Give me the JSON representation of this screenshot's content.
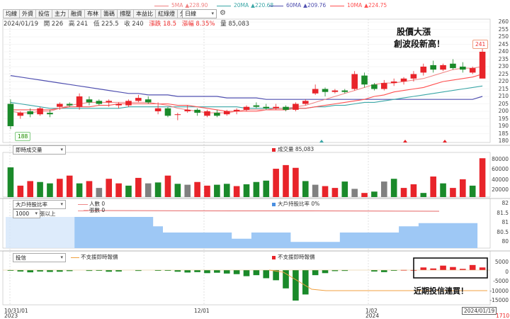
{
  "toolbar": {
    "tabs": [
      "均線",
      "外資",
      "投信",
      "主力",
      "融資",
      "布林",
      "籌碼",
      "撐壓",
      "本益比",
      "紅綠燈",
      "分價量"
    ],
    "period": "日線"
  },
  "ma_legend": [
    {
      "label": "5MA",
      "arrow": "▲",
      "value": "228.90",
      "color": "#f08080"
    },
    {
      "label": "20MA",
      "arrow": "▲",
      "value": "220.68",
      "color": "#3aa6a6"
    },
    {
      "label": "60MA",
      "arrow": "▲",
      "value": "209.76",
      "color": "#5050b0"
    },
    {
      "label": "10MA",
      "arrow": "▲",
      "value": "224.75",
      "color": "#ff5050"
    }
  ],
  "info": {
    "date": "2024/01/19",
    "open": "開 226",
    "high": "高 241",
    "low": "低 225.5",
    "close": "收 240",
    "change": "漲跌 18.5",
    "pct": "漲幅 8.35%",
    "volume": "量 85,083"
  },
  "annotations": {
    "line1": "股價大漲",
    "line2": "創波段新高！",
    "bottom": "近期投信連買！"
  },
  "price_axis": [
    "260",
    "255",
    "250",
    "245",
    "240",
    "235",
    "230",
    "225",
    "220",
    "215",
    "210",
    "205",
    "200",
    "195",
    "190",
    "185",
    "180"
  ],
  "price_high_chip": "241",
  "price_low_chip": "188",
  "volume_panel": {
    "selector": "即時成交量",
    "legend": "成交量 85,083",
    "axis": [
      "80000",
      "60000",
      "40000",
      "20000"
    ]
  },
  "big_panel": {
    "selector": "大戶持股比率",
    "count_selector": "1000",
    "count_suffix": "張以上",
    "legend_people": "人數 0",
    "legend_shares": "張數 0",
    "legend_ratio": "大戶持股比率 0%",
    "axis": [
      "82",
      "81.5",
      "81",
      "80.5",
      "80"
    ]
  },
  "inst_panel": {
    "selector": "投信",
    "legend_line": "不支援即時報價",
    "legend_bar": "不支援即時報價",
    "axis": [
      "5000",
      "0",
      "-5000",
      "-10000",
      "-15000"
    ]
  },
  "x_axis": {
    "labels": [
      "10/31/01",
      "12/01",
      "1/02"
    ],
    "years": [
      "2023",
      "2024"
    ],
    "current_date": "2024/01/19",
    "right_edge": "1710"
  },
  "colors": {
    "up": "#e8242a",
    "down": "#1a8a2a",
    "neutral": "#808080"
  },
  "chart_data": {
    "type": "candlestick",
    "ylim": [
      180,
      262
    ],
    "ohlc": [
      [
        205,
        208,
        188,
        190
      ],
      [
        197,
        200,
        195,
        199
      ],
      [
        200,
        202,
        196,
        198
      ],
      [
        198,
        203,
        197,
        202
      ],
      [
        199,
        201,
        196,
        198
      ],
      [
        203,
        206,
        201,
        205
      ],
      [
        205,
        206,
        203,
        204
      ],
      [
        203,
        212,
        201,
        210
      ],
      [
        208,
        210,
        204,
        206
      ],
      [
        207,
        208,
        204,
        205
      ],
      [
        206,
        208,
        203,
        207
      ],
      [
        204,
        206,
        202,
        205
      ],
      [
        204,
        208,
        203,
        207
      ],
      [
        207,
        211,
        206,
        209
      ],
      [
        208,
        210,
        205,
        206
      ],
      [
        200,
        206,
        198,
        202
      ],
      [
        202,
        203,
        196,
        197
      ],
      [
        198,
        199,
        194,
        198
      ],
      [
        200,
        204,
        199,
        201
      ],
      [
        201,
        202,
        197,
        199
      ],
      [
        197,
        201,
        196,
        200
      ],
      [
        199,
        201,
        196,
        197
      ],
      [
        198,
        201,
        197,
        200
      ],
      [
        200,
        202,
        198,
        201
      ],
      [
        201,
        204,
        200,
        203
      ],
      [
        204,
        206,
        202,
        203
      ],
      [
        203,
        205,
        201,
        202
      ],
      [
        202,
        205,
        201,
        203
      ],
      [
        203,
        204,
        200,
        201
      ],
      [
        201,
        206,
        200,
        205
      ],
      [
        205,
        208,
        204,
        207
      ],
      [
        212,
        218,
        211,
        215
      ],
      [
        215,
        216,
        210,
        213
      ],
      [
        213,
        215,
        212,
        214
      ],
      [
        214,
        215,
        212,
        213
      ],
      [
        215,
        227,
        214,
        225
      ],
      [
        224,
        226,
        216,
        218
      ],
      [
        218,
        219,
        214,
        215
      ],
      [
        215,
        221,
        214,
        219
      ],
      [
        219,
        222,
        217,
        220
      ],
      [
        220,
        223,
        218,
        222
      ],
      [
        222,
        227,
        220,
        225
      ],
      [
        226,
        232,
        224,
        230
      ],
      [
        231,
        234,
        226,
        228
      ],
      [
        228,
        232,
        227,
        231
      ],
      [
        232,
        235,
        228,
        229
      ],
      [
        230,
        233,
        226,
        228
      ],
      [
        226,
        230,
        225,
        229
      ],
      [
        222,
        242,
        225,
        240
      ]
    ],
    "volume": [
      [
        65000,
        0
      ],
      [
        25000,
        1
      ],
      [
        35000,
        1
      ],
      [
        33000,
        0
      ],
      [
        30000,
        0
      ],
      [
        40000,
        1
      ],
      [
        47000,
        1
      ],
      [
        30000,
        0
      ],
      [
        35000,
        1
      ],
      [
        20000,
        2
      ],
      [
        40000,
        1
      ],
      [
        30000,
        1
      ],
      [
        25000,
        0
      ],
      [
        42000,
        1
      ],
      [
        30000,
        2
      ],
      [
        32000,
        0
      ],
      [
        47000,
        1
      ],
      [
        29000,
        0
      ],
      [
        27000,
        2
      ],
      [
        33000,
        1
      ],
      [
        25000,
        1
      ],
      [
        27000,
        0
      ],
      [
        29000,
        0
      ],
      [
        24000,
        1
      ],
      [
        28000,
        0
      ],
      [
        33000,
        0
      ],
      [
        36000,
        0
      ],
      [
        62000,
        1
      ],
      [
        70000,
        1
      ],
      [
        64000,
        1
      ],
      [
        35000,
        0
      ],
      [
        27000,
        2
      ],
      [
        24000,
        1
      ],
      [
        20000,
        1
      ],
      [
        34000,
        0
      ],
      [
        18000,
        2
      ],
      [
        9000,
        1
      ],
      [
        12000,
        0
      ],
      [
        34000,
        2
      ],
      [
        40000,
        0
      ],
      [
        20000,
        1
      ],
      [
        28000,
        1
      ],
      [
        9000,
        0
      ],
      [
        45000,
        1
      ],
      [
        30000,
        0
      ],
      [
        20000,
        1
      ],
      [
        39000,
        1
      ],
      [
        25000,
        0
      ],
      [
        85000,
        1
      ]
    ],
    "institution": [
      -300,
      -700,
      -1100,
      -700,
      -900,
      -800,
      -500,
      0,
      -400,
      -300,
      -800,
      -700,
      0,
      -400,
      0,
      -300,
      -300,
      -800,
      -1200,
      -1000,
      -1500,
      -1300,
      -1700,
      -2000,
      -3000,
      -2500,
      -4000,
      -5000,
      -9000,
      -15000,
      -12000,
      -2500,
      -1500,
      -500,
      -400,
      0,
      0,
      -700,
      -1000,
      -300,
      100,
      50,
      1300,
      800,
      2200,
      1500,
      600,
      2500,
      1300
    ],
    "ma5": [
      200,
      199,
      199,
      200,
      200,
      202,
      204,
      205,
      206,
      206,
      206,
      206,
      206,
      206,
      206,
      205,
      204,
      202,
      201,
      200,
      199,
      199,
      199,
      200,
      201,
      201,
      201,
      202,
      202,
      203,
      204,
      206,
      208,
      210,
      212,
      214,
      216,
      218,
      219,
      219,
      220,
      221,
      222,
      224,
      226,
      228,
      229,
      229,
      230
    ],
    "ma10": [
      201,
      201,
      201,
      201,
      201,
      202,
      203,
      203,
      203,
      204,
      204,
      205,
      205,
      205,
      205,
      205,
      205,
      204,
      204,
      203,
      202,
      201,
      200,
      200,
      200,
      200,
      201,
      201,
      201,
      202,
      202,
      203,
      204,
      205,
      206,
      207,
      208,
      210,
      211,
      213,
      214,
      215,
      216,
      218,
      220,
      221,
      222,
      223,
      225
    ],
    "ma20": [
      206,
      205,
      204,
      203,
      202,
      202,
      202,
      202,
      202,
      202,
      202,
      202,
      203,
      203,
      203,
      203,
      203,
      203,
      203,
      203,
      203,
      203,
      203,
      203,
      202,
      202,
      202,
      202,
      202,
      202,
      202,
      203,
      203,
      204,
      204,
      205,
      206,
      206,
      207,
      208,
      209,
      210,
      211,
      212,
      213,
      214,
      215,
      216,
      217
    ],
    "ma60": [
      224,
      223,
      222,
      221,
      220,
      219,
      218,
      217,
      216,
      215,
      214,
      213,
      212,
      212,
      211,
      211,
      211,
      210,
      210,
      210,
      210,
      210,
      209,
      209,
      209,
      209,
      208,
      208,
      208,
      208,
      208,
      208,
      208,
      208,
      208,
      208,
      208,
      208,
      208,
      208,
      208,
      208,
      208,
      208,
      208,
      208,
      208,
      208,
      210
    ],
    "big_ratio": [
      0,
      0,
      0,
      0,
      0,
      0,
      0,
      1,
      1,
      1,
      1,
      1,
      1,
      1,
      1,
      0.7,
      0.5,
      0.5,
      0.5,
      0.5,
      0.5,
      0.5,
      0.5,
      0.3,
      0.3,
      0.5,
      0.5,
      0.5,
      0.5,
      0.2,
      0.2,
      0.2,
      0.2,
      0.2,
      0.5,
      0.5,
      0.5,
      0.5,
      0.5,
      0.5,
      0.7,
      0.7,
      0.8,
      0.8,
      0.8,
      0.8,
      0.8,
      0.8,
      null
    ]
  }
}
